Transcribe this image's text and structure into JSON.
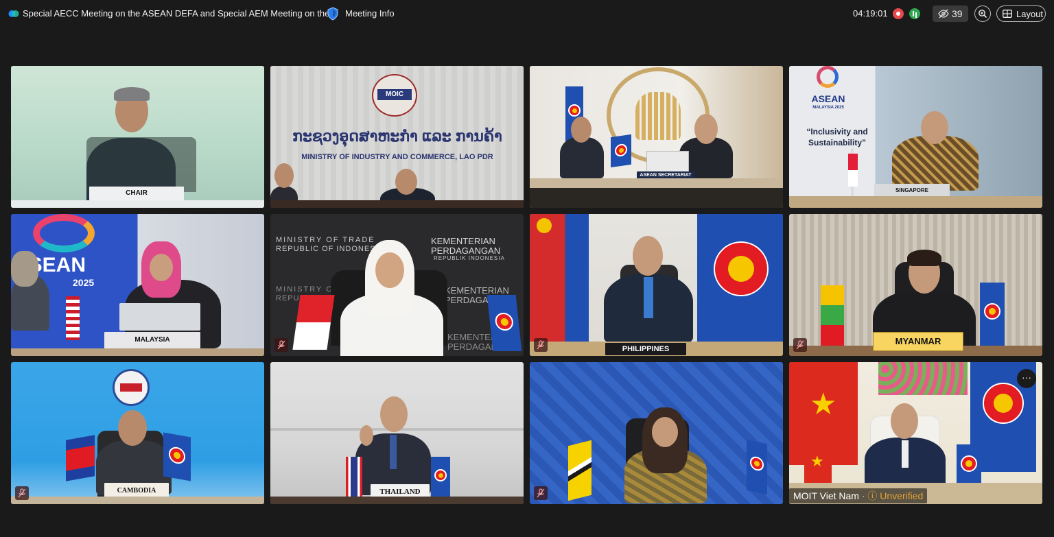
{
  "header": {
    "meeting_title": "Special AECC Meeting on the ASEAN DEFA and Special AEM Meeting on the...",
    "meeting_info_label": "Meeting Info",
    "elapsed_time": "04:19:01",
    "participant_count": "39",
    "layout_label": "Layout"
  },
  "tiles": [
    {
      "id": "chair",
      "nameplate": "CHAIR",
      "muted": false
    },
    {
      "id": "lao",
      "sign_logo": "MOIC",
      "sign_lao": "ກະຊວງອຸດສາຫະກຳ ແລະ ການຄ້າ",
      "sign_english": "MINISTRY OF INDUSTRY AND COMMERCE, LAO PDR",
      "muted": false
    },
    {
      "id": "asean-secretariat",
      "nameplate": "ASEAN SECRETARIAT",
      "muted": false
    },
    {
      "id": "singapore",
      "banner_line1": "ASEAN",
      "banner_line2": "MALAYSIA 2025",
      "quote": "“Inclusivity and Sustainability”",
      "nameplate": "SINGAPORE",
      "muted": false
    },
    {
      "id": "malaysia",
      "banner_line1": "ASEAN",
      "banner_line2": "2025",
      "nameplate": "MALAYSIA",
      "muted": false
    },
    {
      "id": "indonesia",
      "wall_text_1": "MINISTRY OF TRADE",
      "wall_text_2": "REPUBLIC OF INDONESIA",
      "wall_text_3": "KEMENTERIAN",
      "wall_text_4": "PERDAGANGAN",
      "wall_text_5": "REPUBLIK INDONESIA",
      "muted": true
    },
    {
      "id": "philippines",
      "nameplate": "PHILIPPINES",
      "muted": true
    },
    {
      "id": "myanmar",
      "nameplate": "MYANMAR",
      "muted": true
    },
    {
      "id": "cambodia",
      "nameplate": "CAMBODIA",
      "muted": true
    },
    {
      "id": "thailand",
      "nameplate": "THAILAND",
      "muted": false
    },
    {
      "id": "brunei",
      "muted": true
    },
    {
      "id": "vietnam",
      "display_name": "MOIT Viet Nam",
      "status": "Unverified",
      "muted": false
    }
  ],
  "colors": {
    "background": "#1a1a1a",
    "record": "#e5484d",
    "live": "#2fa84f",
    "unverified": "#e3a33a",
    "asean_blue": "#1f4fb0"
  },
  "icons": [
    "webex-logo-icon",
    "shield-icon",
    "record-icon",
    "live-icon",
    "participants-hidden-icon",
    "zoom-icon",
    "layout-grid-icon",
    "mic-muted-icon",
    "more-options-icon"
  ]
}
